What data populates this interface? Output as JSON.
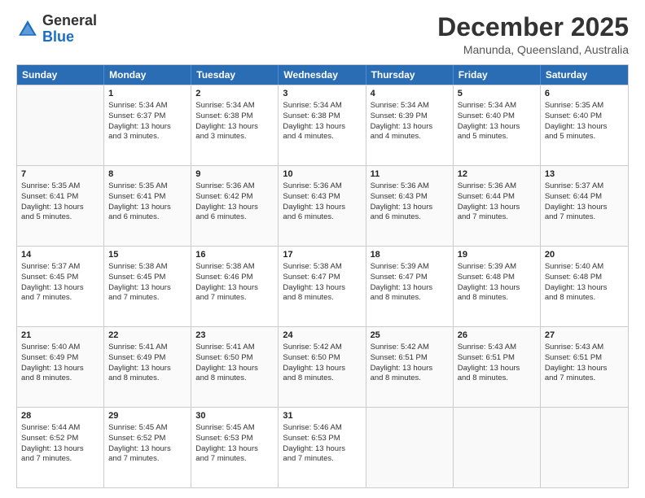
{
  "logo": {
    "general": "General",
    "blue": "Blue"
  },
  "title": "December 2025",
  "subtitle": "Manunda, Queensland, Australia",
  "header_days": [
    "Sunday",
    "Monday",
    "Tuesday",
    "Wednesday",
    "Thursday",
    "Friday",
    "Saturday"
  ],
  "rows": [
    [
      {
        "day": "",
        "empty": true
      },
      {
        "day": "1",
        "line1": "Sunrise: 5:34 AM",
        "line2": "Sunset: 6:37 PM",
        "line3": "Daylight: 13 hours",
        "line4": "and 3 minutes."
      },
      {
        "day": "2",
        "line1": "Sunrise: 5:34 AM",
        "line2": "Sunset: 6:38 PM",
        "line3": "Daylight: 13 hours",
        "line4": "and 3 minutes."
      },
      {
        "day": "3",
        "line1": "Sunrise: 5:34 AM",
        "line2": "Sunset: 6:38 PM",
        "line3": "Daylight: 13 hours",
        "line4": "and 4 minutes."
      },
      {
        "day": "4",
        "line1": "Sunrise: 5:34 AM",
        "line2": "Sunset: 6:39 PM",
        "line3": "Daylight: 13 hours",
        "line4": "and 4 minutes."
      },
      {
        "day": "5",
        "line1": "Sunrise: 5:34 AM",
        "line2": "Sunset: 6:40 PM",
        "line3": "Daylight: 13 hours",
        "line4": "and 5 minutes."
      },
      {
        "day": "6",
        "line1": "Sunrise: 5:35 AM",
        "line2": "Sunset: 6:40 PM",
        "line3": "Daylight: 13 hours",
        "line4": "and 5 minutes."
      }
    ],
    [
      {
        "day": "7",
        "line1": "Sunrise: 5:35 AM",
        "line2": "Sunset: 6:41 PM",
        "line3": "Daylight: 13 hours",
        "line4": "and 5 minutes."
      },
      {
        "day": "8",
        "line1": "Sunrise: 5:35 AM",
        "line2": "Sunset: 6:41 PM",
        "line3": "Daylight: 13 hours",
        "line4": "and 6 minutes."
      },
      {
        "day": "9",
        "line1": "Sunrise: 5:36 AM",
        "line2": "Sunset: 6:42 PM",
        "line3": "Daylight: 13 hours",
        "line4": "and 6 minutes."
      },
      {
        "day": "10",
        "line1": "Sunrise: 5:36 AM",
        "line2": "Sunset: 6:43 PM",
        "line3": "Daylight: 13 hours",
        "line4": "and 6 minutes."
      },
      {
        "day": "11",
        "line1": "Sunrise: 5:36 AM",
        "line2": "Sunset: 6:43 PM",
        "line3": "Daylight: 13 hours",
        "line4": "and 6 minutes."
      },
      {
        "day": "12",
        "line1": "Sunrise: 5:36 AM",
        "line2": "Sunset: 6:44 PM",
        "line3": "Daylight: 13 hours",
        "line4": "and 7 minutes."
      },
      {
        "day": "13",
        "line1": "Sunrise: 5:37 AM",
        "line2": "Sunset: 6:44 PM",
        "line3": "Daylight: 13 hours",
        "line4": "and 7 minutes."
      }
    ],
    [
      {
        "day": "14",
        "line1": "Sunrise: 5:37 AM",
        "line2": "Sunset: 6:45 PM",
        "line3": "Daylight: 13 hours",
        "line4": "and 7 minutes."
      },
      {
        "day": "15",
        "line1": "Sunrise: 5:38 AM",
        "line2": "Sunset: 6:45 PM",
        "line3": "Daylight: 13 hours",
        "line4": "and 7 minutes."
      },
      {
        "day": "16",
        "line1": "Sunrise: 5:38 AM",
        "line2": "Sunset: 6:46 PM",
        "line3": "Daylight: 13 hours",
        "line4": "and 7 minutes."
      },
      {
        "day": "17",
        "line1": "Sunrise: 5:38 AM",
        "line2": "Sunset: 6:47 PM",
        "line3": "Daylight: 13 hours",
        "line4": "and 8 minutes."
      },
      {
        "day": "18",
        "line1": "Sunrise: 5:39 AM",
        "line2": "Sunset: 6:47 PM",
        "line3": "Daylight: 13 hours",
        "line4": "and 8 minutes."
      },
      {
        "day": "19",
        "line1": "Sunrise: 5:39 AM",
        "line2": "Sunset: 6:48 PM",
        "line3": "Daylight: 13 hours",
        "line4": "and 8 minutes."
      },
      {
        "day": "20",
        "line1": "Sunrise: 5:40 AM",
        "line2": "Sunset: 6:48 PM",
        "line3": "Daylight: 13 hours",
        "line4": "and 8 minutes."
      }
    ],
    [
      {
        "day": "21",
        "line1": "Sunrise: 5:40 AM",
        "line2": "Sunset: 6:49 PM",
        "line3": "Daylight: 13 hours",
        "line4": "and 8 minutes."
      },
      {
        "day": "22",
        "line1": "Sunrise: 5:41 AM",
        "line2": "Sunset: 6:49 PM",
        "line3": "Daylight: 13 hours",
        "line4": "and 8 minutes."
      },
      {
        "day": "23",
        "line1": "Sunrise: 5:41 AM",
        "line2": "Sunset: 6:50 PM",
        "line3": "Daylight: 13 hours",
        "line4": "and 8 minutes."
      },
      {
        "day": "24",
        "line1": "Sunrise: 5:42 AM",
        "line2": "Sunset: 6:50 PM",
        "line3": "Daylight: 13 hours",
        "line4": "and 8 minutes."
      },
      {
        "day": "25",
        "line1": "Sunrise: 5:42 AM",
        "line2": "Sunset: 6:51 PM",
        "line3": "Daylight: 13 hours",
        "line4": "and 8 minutes."
      },
      {
        "day": "26",
        "line1": "Sunrise: 5:43 AM",
        "line2": "Sunset: 6:51 PM",
        "line3": "Daylight: 13 hours",
        "line4": "and 8 minutes."
      },
      {
        "day": "27",
        "line1": "Sunrise: 5:43 AM",
        "line2": "Sunset: 6:51 PM",
        "line3": "Daylight: 13 hours",
        "line4": "and 7 minutes."
      }
    ],
    [
      {
        "day": "28",
        "line1": "Sunrise: 5:44 AM",
        "line2": "Sunset: 6:52 PM",
        "line3": "Daylight: 13 hours",
        "line4": "and 7 minutes."
      },
      {
        "day": "29",
        "line1": "Sunrise: 5:45 AM",
        "line2": "Sunset: 6:52 PM",
        "line3": "Daylight: 13 hours",
        "line4": "and 7 minutes."
      },
      {
        "day": "30",
        "line1": "Sunrise: 5:45 AM",
        "line2": "Sunset: 6:53 PM",
        "line3": "Daylight: 13 hours",
        "line4": "and 7 minutes."
      },
      {
        "day": "31",
        "line1": "Sunrise: 5:46 AM",
        "line2": "Sunset: 6:53 PM",
        "line3": "Daylight: 13 hours",
        "line4": "and 7 minutes."
      },
      {
        "day": "",
        "empty": true
      },
      {
        "day": "",
        "empty": true
      },
      {
        "day": "",
        "empty": true
      }
    ]
  ]
}
